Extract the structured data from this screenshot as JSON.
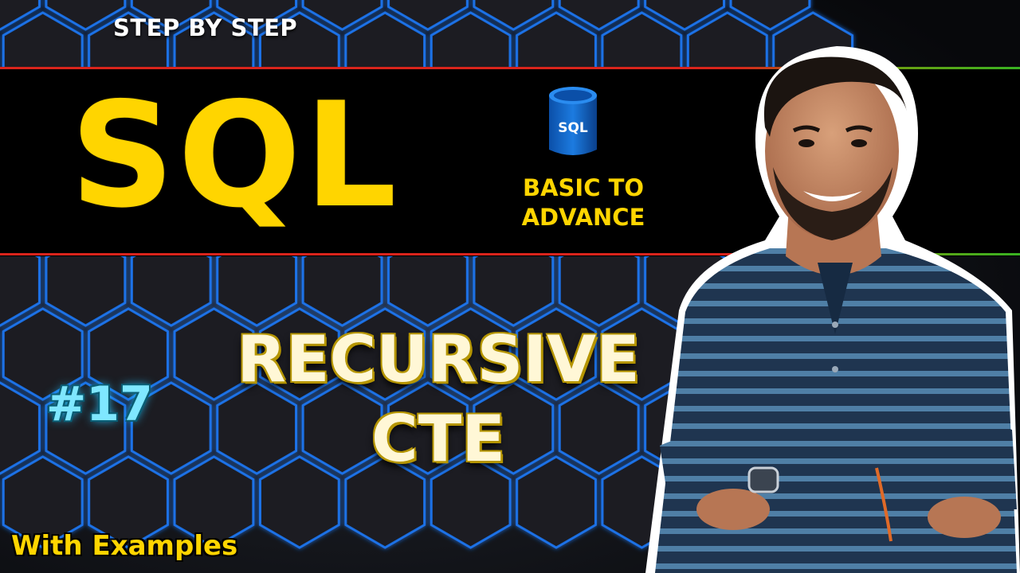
{
  "thumbnail": {
    "step_label": "STEP BY STEP",
    "course_title": "SQL",
    "badge": {
      "icon": "database-icon",
      "icon_label": "SQL",
      "line1": "BASIC TO",
      "line2": "ADVANCE"
    },
    "episode": "#17",
    "topic_line1": "RECURSIVE",
    "topic_line2": "CTE",
    "subtitle": "With Examples",
    "presenter": "presenter-photo"
  },
  "colors": {
    "accent_yellow": "#ffd500",
    "banner_black": "#000000",
    "line_red": "#d9241c",
    "line_green": "#38b222",
    "hex_glow": "#1e7dff",
    "episode_cyan": "#7fe7ff",
    "shirt_navy": "#1f3550",
    "shirt_stripe": "#4f7fa6"
  }
}
